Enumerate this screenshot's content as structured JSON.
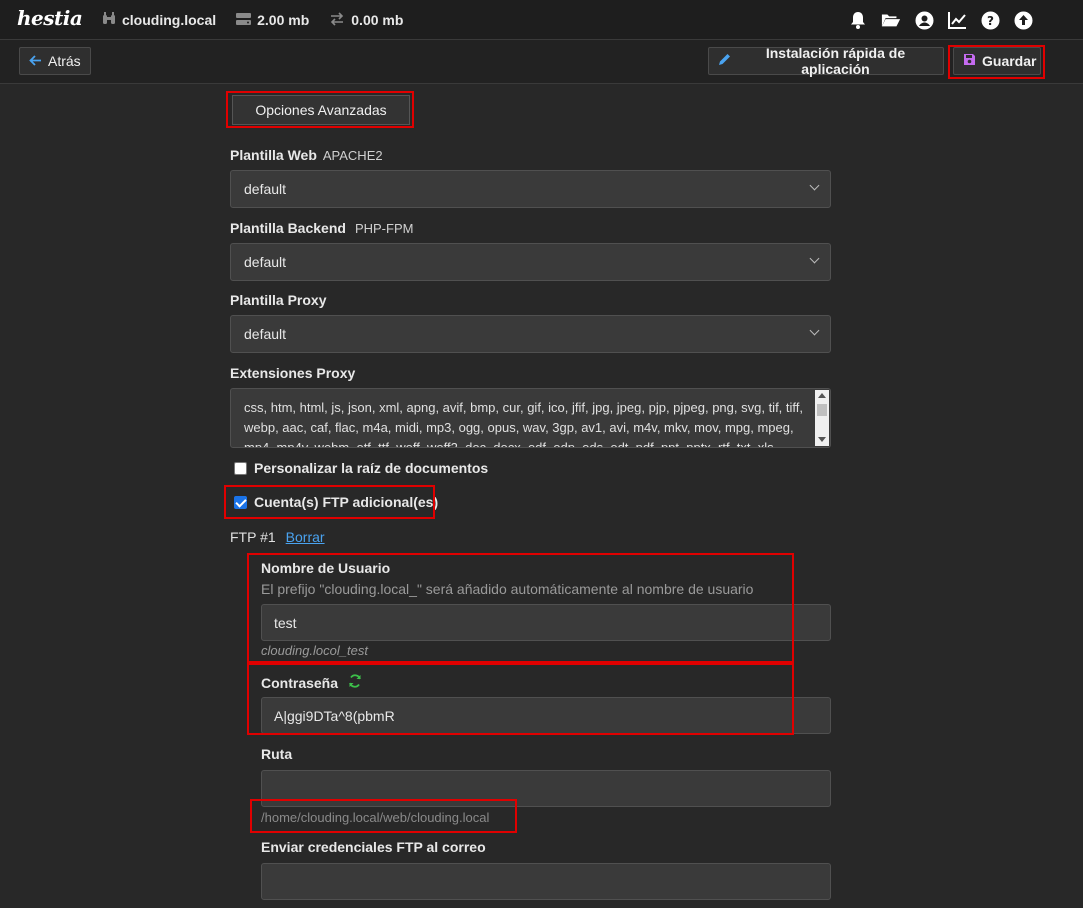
{
  "topbar": {
    "logo": "hestia",
    "domain": "clouding.local",
    "disk": "2.00 mb",
    "bandwidth": "0.00 mb",
    "icons": [
      "bell-icon",
      "folder-icon",
      "user-icon",
      "stats-icon",
      "help-icon",
      "upload-icon"
    ]
  },
  "toolbar": {
    "back_label": "Atrás",
    "install_label": "Instalación rápida de aplicación",
    "save_label": "Guardar"
  },
  "form": {
    "advanced_button": "Opciones Avanzadas",
    "web_template": {
      "label": "Plantilla Web",
      "sub": "APACHE2",
      "value": "default"
    },
    "backend_template": {
      "label": "Plantilla Backend",
      "sub": "PHP-FPM",
      "value": "default"
    },
    "proxy_template": {
      "label": "Plantilla Proxy",
      "value": "default"
    },
    "proxy_extensions": {
      "label": "Extensiones Proxy",
      "value": "css, htm, html, js, json, xml, apng, avif, bmp, cur, gif, ico, jfif, jpg, jpeg, pjp, pjpeg, png, svg, tif, tiff, webp, aac, caf, flac, m4a, midi, mp3, ogg, opus, wav, 3gp, av1, avi, m4v, mkv, mov, mpg, mpeg, mp4, mp4v, webm, otf, ttf, woff, woff2, doc, docx, odf, odp, ods, odt, pdf, ppt, pptx, rtf, txt, xls"
    },
    "custom_docroot": {
      "label": "Personalizar la raíz de documentos",
      "checked": false
    },
    "additional_ftp": {
      "label": "Cuenta(s) FTP adicional(es)",
      "checked": true
    },
    "ftp": {
      "title": "FTP #1",
      "delete_link": "Borrar",
      "username_label": "Nombre de Usuario",
      "username_hint": "El prefijo \"clouding.local_\" será añadido automáticamente al nombre de usuario",
      "username_value": "test",
      "username_preview": "clouding.locol_test",
      "password_label": "Contraseña",
      "password_value": "A|ggi9DTa^8(pbmR",
      "path_label": "Ruta",
      "path_value": "",
      "path_hint": "/home/clouding.local/web/clouding.local",
      "send_label": "Enviar credenciales FTP al correo",
      "send_value": ""
    }
  },
  "colors": {
    "highlight": "#e00000",
    "link": "#4aa3f0",
    "save_icon": "#c56bf0",
    "refresh_icon": "#3cc04a"
  }
}
